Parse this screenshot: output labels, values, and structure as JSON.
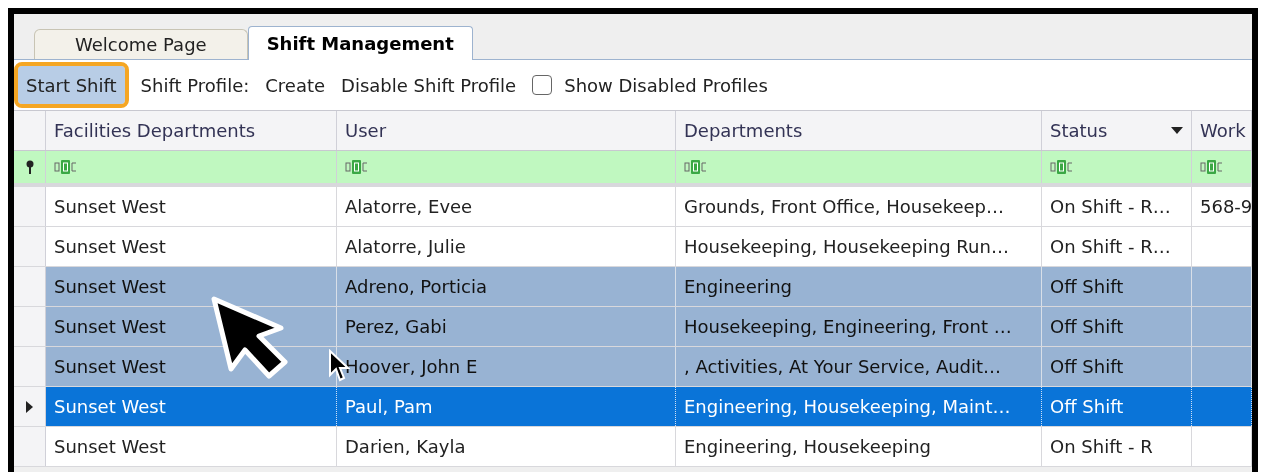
{
  "tabs": [
    {
      "label": "Welcome Page",
      "selected": false
    },
    {
      "label": "Shift Management",
      "selected": true
    }
  ],
  "toolbar": {
    "start_button": "Start Shift",
    "profile_label": "Shift Profile:",
    "create_button": "Create",
    "disable_button": "Disable Shift Profile",
    "show_disabled": {
      "label": "Show Disabled Profiles",
      "checked": false
    }
  },
  "table": {
    "columns": [
      {
        "label": "Facilities Departments",
        "kind": "plain"
      },
      {
        "label": "User",
        "kind": "plain"
      },
      {
        "label": "Departments",
        "kind": "plain"
      },
      {
        "label": "Status",
        "kind": "dropdown"
      },
      {
        "label": "Work",
        "kind": "plain"
      }
    ],
    "rows": [
      {
        "cells": [
          "Sunset West",
          "Alatorre, Evee",
          "Grounds, Front Office, Housekeep…",
          "On Shift - R…",
          "568-9"
        ],
        "selected": false,
        "focused": false
      },
      {
        "cells": [
          "Sunset West",
          "Alatorre, Julie",
          "Housekeeping, Housekeeping Run…",
          "On Shift - R…",
          ""
        ],
        "selected": false,
        "focused": false
      },
      {
        "cells": [
          "Sunset West",
          "Adreno, Porticia",
          "Engineering",
          "Off Shift",
          ""
        ],
        "selected": true,
        "focused": false
      },
      {
        "cells": [
          "Sunset West",
          "Perez, Gabi",
          "Housekeeping, Engineering, Front …",
          "Off Shift",
          ""
        ],
        "selected": true,
        "focused": false
      },
      {
        "cells": [
          "Sunset West",
          "Hoover, John E",
          ", Activities, At Your Service, Audit…",
          "Off Shift",
          ""
        ],
        "selected": true,
        "focused": false
      },
      {
        "cells": [
          "Sunset West",
          "Paul, Pam",
          "Engineering, Housekeeping, Maint…",
          "Off Shift",
          ""
        ],
        "selected": true,
        "focused": true
      },
      {
        "cells": [
          "Sunset West",
          "Darien, Kayla",
          "Engineering, Housekeeping",
          "On Shift - R",
          ""
        ],
        "selected": false,
        "focused": false
      }
    ]
  }
}
